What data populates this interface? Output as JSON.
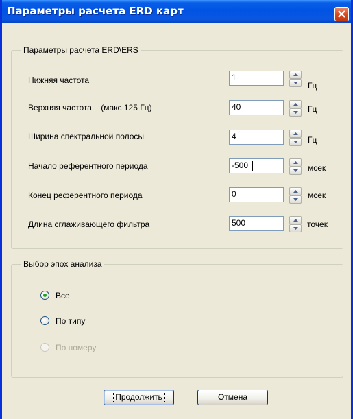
{
  "window": {
    "title": "Параметры расчета ERD карт"
  },
  "params_group": {
    "legend": "Параметры расчета ERD\\ERS",
    "rows": [
      {
        "label": "Нижняя частота",
        "value": "1",
        "unit": "Гц"
      },
      {
        "label": "Верхняя частота    (макс 125 Гц)",
        "value": "40",
        "unit": "Гц"
      },
      {
        "label": "Ширина спектральной полосы",
        "value": "4",
        "unit": "Гц"
      },
      {
        "label": "Начало референтного периода",
        "value": "-500",
        "unit": "мсек"
      },
      {
        "label": "Конец референтного периода",
        "value": "0",
        "unit": "мсек"
      },
      {
        "label": "Длина сглаживающего фильтра",
        "value": "500",
        "unit": "точек"
      }
    ]
  },
  "epoch_group": {
    "legend": "Выбор эпох анализа",
    "options": [
      {
        "label": "Все",
        "selected": true,
        "enabled": true
      },
      {
        "label": "По типу",
        "selected": false,
        "enabled": true
      },
      {
        "label": "По номеру",
        "selected": false,
        "enabled": false
      }
    ]
  },
  "buttons": {
    "continue_label": "Продолжить",
    "cancel_label": "Отмена"
  },
  "colors": {
    "titlebar": "#0054E3",
    "dialog_bg": "#ECE9D8",
    "close_button": "#D8491C",
    "radio_dot": "#21A121"
  }
}
